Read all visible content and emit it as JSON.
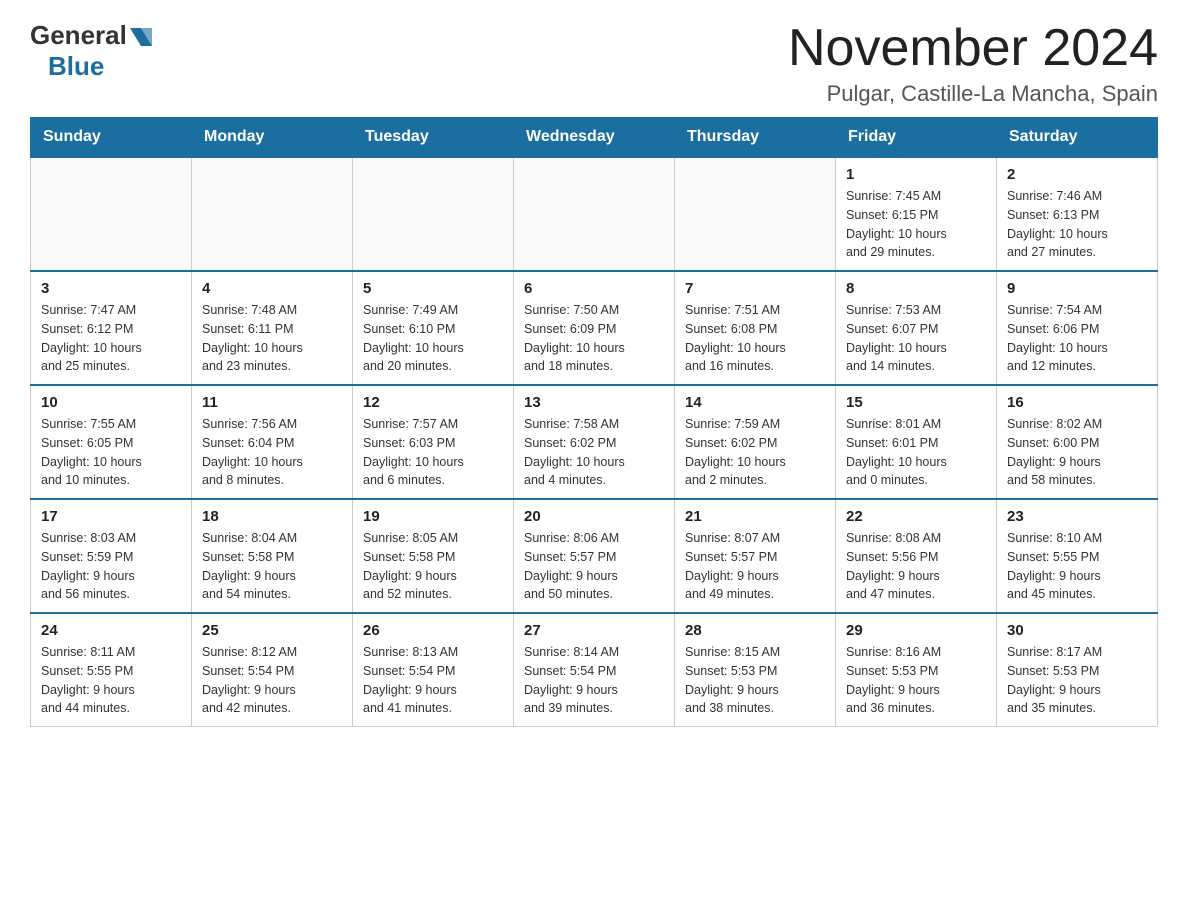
{
  "header": {
    "logo_general": "General",
    "logo_blue": "Blue",
    "month_title": "November 2024",
    "location": "Pulgar, Castille-La Mancha, Spain"
  },
  "weekdays": [
    "Sunday",
    "Monday",
    "Tuesday",
    "Wednesday",
    "Thursday",
    "Friday",
    "Saturday"
  ],
  "weeks": [
    [
      {
        "day": "",
        "info": ""
      },
      {
        "day": "",
        "info": ""
      },
      {
        "day": "",
        "info": ""
      },
      {
        "day": "",
        "info": ""
      },
      {
        "day": "",
        "info": ""
      },
      {
        "day": "1",
        "info": "Sunrise: 7:45 AM\nSunset: 6:15 PM\nDaylight: 10 hours\nand 29 minutes."
      },
      {
        "day": "2",
        "info": "Sunrise: 7:46 AM\nSunset: 6:13 PM\nDaylight: 10 hours\nand 27 minutes."
      }
    ],
    [
      {
        "day": "3",
        "info": "Sunrise: 7:47 AM\nSunset: 6:12 PM\nDaylight: 10 hours\nand 25 minutes."
      },
      {
        "day": "4",
        "info": "Sunrise: 7:48 AM\nSunset: 6:11 PM\nDaylight: 10 hours\nand 23 minutes."
      },
      {
        "day": "5",
        "info": "Sunrise: 7:49 AM\nSunset: 6:10 PM\nDaylight: 10 hours\nand 20 minutes."
      },
      {
        "day": "6",
        "info": "Sunrise: 7:50 AM\nSunset: 6:09 PM\nDaylight: 10 hours\nand 18 minutes."
      },
      {
        "day": "7",
        "info": "Sunrise: 7:51 AM\nSunset: 6:08 PM\nDaylight: 10 hours\nand 16 minutes."
      },
      {
        "day": "8",
        "info": "Sunrise: 7:53 AM\nSunset: 6:07 PM\nDaylight: 10 hours\nand 14 minutes."
      },
      {
        "day": "9",
        "info": "Sunrise: 7:54 AM\nSunset: 6:06 PM\nDaylight: 10 hours\nand 12 minutes."
      }
    ],
    [
      {
        "day": "10",
        "info": "Sunrise: 7:55 AM\nSunset: 6:05 PM\nDaylight: 10 hours\nand 10 minutes."
      },
      {
        "day": "11",
        "info": "Sunrise: 7:56 AM\nSunset: 6:04 PM\nDaylight: 10 hours\nand 8 minutes."
      },
      {
        "day": "12",
        "info": "Sunrise: 7:57 AM\nSunset: 6:03 PM\nDaylight: 10 hours\nand 6 minutes."
      },
      {
        "day": "13",
        "info": "Sunrise: 7:58 AM\nSunset: 6:02 PM\nDaylight: 10 hours\nand 4 minutes."
      },
      {
        "day": "14",
        "info": "Sunrise: 7:59 AM\nSunset: 6:02 PM\nDaylight: 10 hours\nand 2 minutes."
      },
      {
        "day": "15",
        "info": "Sunrise: 8:01 AM\nSunset: 6:01 PM\nDaylight: 10 hours\nand 0 minutes."
      },
      {
        "day": "16",
        "info": "Sunrise: 8:02 AM\nSunset: 6:00 PM\nDaylight: 9 hours\nand 58 minutes."
      }
    ],
    [
      {
        "day": "17",
        "info": "Sunrise: 8:03 AM\nSunset: 5:59 PM\nDaylight: 9 hours\nand 56 minutes."
      },
      {
        "day": "18",
        "info": "Sunrise: 8:04 AM\nSunset: 5:58 PM\nDaylight: 9 hours\nand 54 minutes."
      },
      {
        "day": "19",
        "info": "Sunrise: 8:05 AM\nSunset: 5:58 PM\nDaylight: 9 hours\nand 52 minutes."
      },
      {
        "day": "20",
        "info": "Sunrise: 8:06 AM\nSunset: 5:57 PM\nDaylight: 9 hours\nand 50 minutes."
      },
      {
        "day": "21",
        "info": "Sunrise: 8:07 AM\nSunset: 5:57 PM\nDaylight: 9 hours\nand 49 minutes."
      },
      {
        "day": "22",
        "info": "Sunrise: 8:08 AM\nSunset: 5:56 PM\nDaylight: 9 hours\nand 47 minutes."
      },
      {
        "day": "23",
        "info": "Sunrise: 8:10 AM\nSunset: 5:55 PM\nDaylight: 9 hours\nand 45 minutes."
      }
    ],
    [
      {
        "day": "24",
        "info": "Sunrise: 8:11 AM\nSunset: 5:55 PM\nDaylight: 9 hours\nand 44 minutes."
      },
      {
        "day": "25",
        "info": "Sunrise: 8:12 AM\nSunset: 5:54 PM\nDaylight: 9 hours\nand 42 minutes."
      },
      {
        "day": "26",
        "info": "Sunrise: 8:13 AM\nSunset: 5:54 PM\nDaylight: 9 hours\nand 41 minutes."
      },
      {
        "day": "27",
        "info": "Sunrise: 8:14 AM\nSunset: 5:54 PM\nDaylight: 9 hours\nand 39 minutes."
      },
      {
        "day": "28",
        "info": "Sunrise: 8:15 AM\nSunset: 5:53 PM\nDaylight: 9 hours\nand 38 minutes."
      },
      {
        "day": "29",
        "info": "Sunrise: 8:16 AM\nSunset: 5:53 PM\nDaylight: 9 hours\nand 36 minutes."
      },
      {
        "day": "30",
        "info": "Sunrise: 8:17 AM\nSunset: 5:53 PM\nDaylight: 9 hours\nand 35 minutes."
      }
    ]
  ]
}
